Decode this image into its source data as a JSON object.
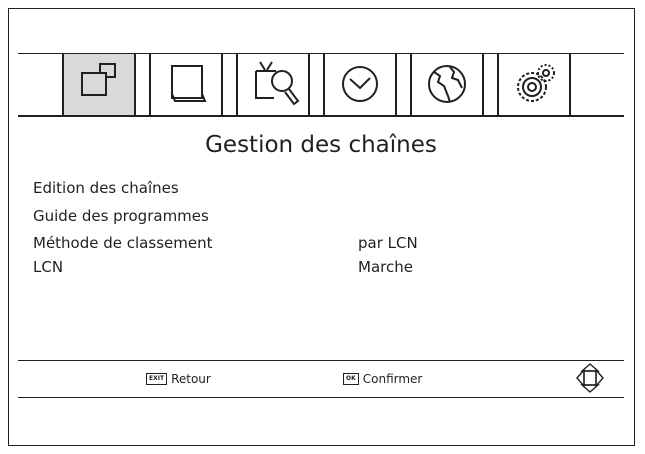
{
  "tabs": [
    {
      "icon": "channels-icon",
      "selected": true
    },
    {
      "icon": "picture-icon",
      "selected": false
    },
    {
      "icon": "tv-search-icon",
      "selected": false
    },
    {
      "icon": "clock-icon",
      "selected": false
    },
    {
      "icon": "globe-icon",
      "selected": false
    },
    {
      "icon": "settings-gear-icon",
      "selected": false
    }
  ],
  "menu": {
    "title": "Gestion des chaînes",
    "items": [
      {
        "label": "Edition des chaînes",
        "value": ""
      },
      {
        "label": "Guide des programmes",
        "value": ""
      },
      {
        "label": "Méthode de classement",
        "value": "par LCN"
      },
      {
        "label": "LCN",
        "value": "Marche"
      }
    ]
  },
  "footer": {
    "exit_key": "EXIT",
    "exit_label": "Retour",
    "ok_key": "OK",
    "ok_label": "Confirmer",
    "nav_icon": "navigation-arrows-icon"
  }
}
